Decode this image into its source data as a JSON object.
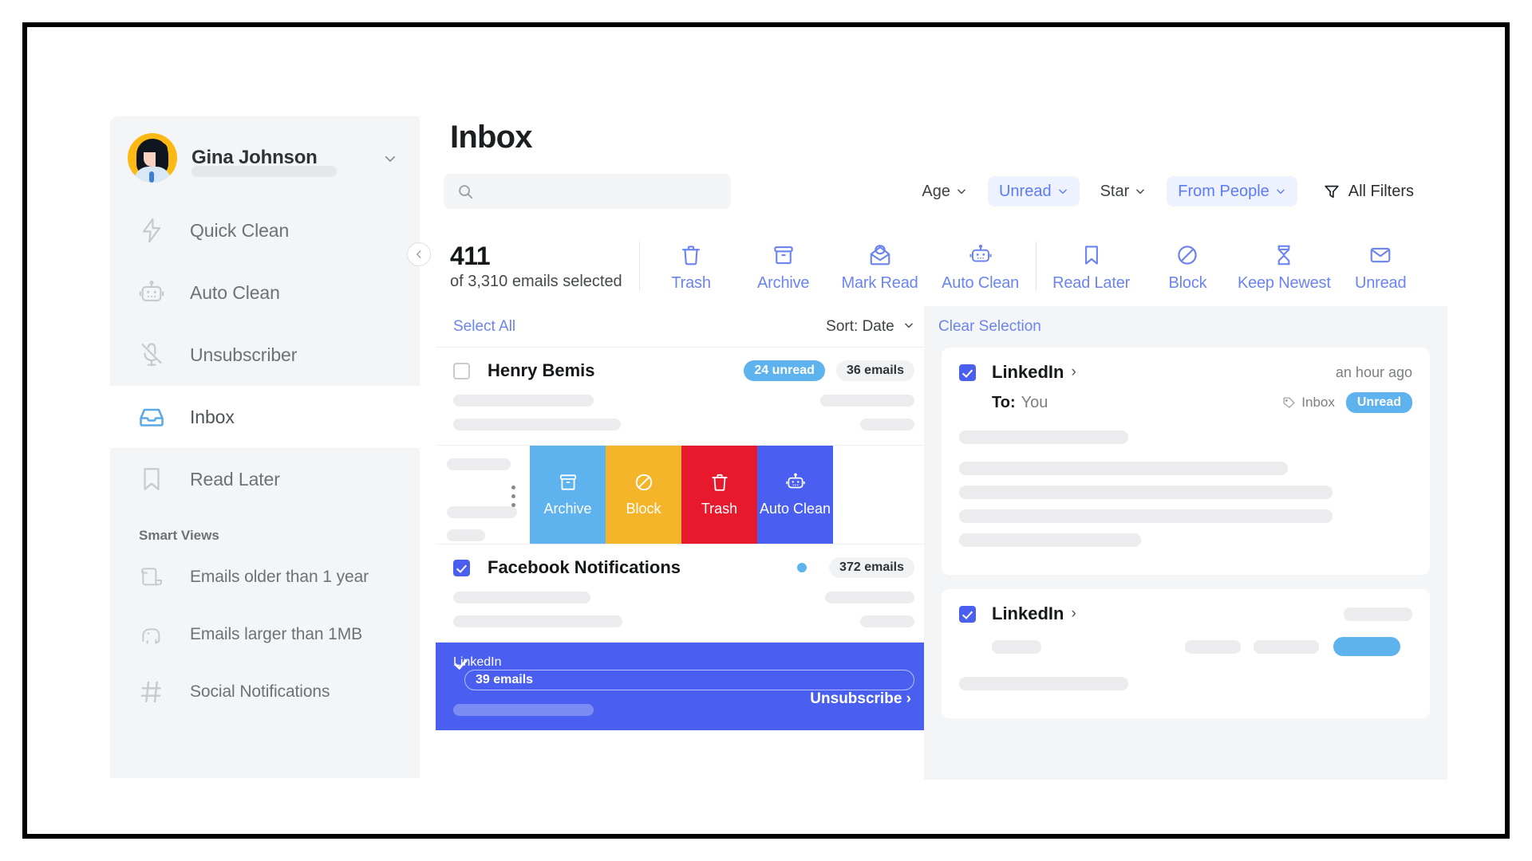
{
  "app": {
    "title": "Inbox"
  },
  "sidebar": {
    "profile": {
      "name": "Gina Johnson",
      "chevron_icon": "chevron-down-icon",
      "avatar_icon": "avatar"
    },
    "items": [
      {
        "label": "Quick Clean",
        "icon": "bolt-icon",
        "active": false
      },
      {
        "label": "Auto Clean",
        "icon": "robot-icon",
        "active": false
      },
      {
        "label": "Unsubscriber",
        "icon": "mic-muted-icon",
        "active": false
      },
      {
        "label": "Inbox",
        "icon": "inbox-icon",
        "active": true
      },
      {
        "label": "Read Later",
        "icon": "bookmark-icon",
        "active": false
      }
    ],
    "smart_views_title": "Smart Views",
    "smart_views": [
      {
        "label": "Emails older than 1 year",
        "icon": "scroll-icon"
      },
      {
        "label": "Emails larger than 1MB",
        "icon": "elephant-icon"
      },
      {
        "label": "Social Notifications",
        "icon": "hash-icon"
      }
    ],
    "collapse_icon": "chevron-left-icon"
  },
  "filters": {
    "search_placeholder": "",
    "search_value": "",
    "search_icon": "search-icon",
    "chips": [
      {
        "label": "Age",
        "active": false,
        "caret": "chevron-down-icon"
      },
      {
        "label": "Unread",
        "active": true,
        "caret": "chevron-down-icon"
      },
      {
        "label": "Star",
        "active": false,
        "caret": "chevron-down-icon"
      },
      {
        "label": "From People",
        "active": true,
        "caret": "chevron-down-icon"
      }
    ],
    "all_filters_label": "All Filters",
    "all_filters_icon": "funnel-icon"
  },
  "selection": {
    "count": "411",
    "summary": "of 3,310 emails selected"
  },
  "actions_primary": [
    {
      "label": "Trash",
      "icon": "trash-icon"
    },
    {
      "label": "Archive",
      "icon": "archive-icon"
    },
    {
      "label": "Mark Read",
      "icon": "open-envelope-icon"
    },
    {
      "label": "Auto Clean",
      "icon": "robot-icon"
    }
  ],
  "actions_secondary": [
    {
      "label": "Read Later",
      "icon": "bookmark-icon"
    },
    {
      "label": "Block",
      "icon": "block-icon"
    },
    {
      "label": "Keep Newest",
      "icon": "hourglass-icon"
    },
    {
      "label": "Unread",
      "icon": "envelope-icon"
    }
  ],
  "list": {
    "select_all_label": "Select All",
    "sort_label": "Sort: Date",
    "sort_caret": "chevron-down-icon",
    "rows": [
      {
        "sender": "Henry Bemis",
        "checked": false,
        "unread_pill": "24 unread",
        "count_pill": "36 emails",
        "show_dot": false
      },
      {
        "sender": "Facebook Notifications",
        "checked": true,
        "unread_pill": "",
        "count_pill": "372 emails",
        "show_dot": true
      },
      {
        "sender": "LinkedIn",
        "checked": true,
        "unread_pill": "",
        "count_pill": "39 emails",
        "show_dot": true,
        "unsubscribe_label": "Unsubscribe ›",
        "selected": true
      }
    ],
    "swipe_actions": [
      {
        "label": "Archive",
        "icon": "archive-icon",
        "color": "#5eb3ef"
      },
      {
        "label": "Block",
        "icon": "block-icon",
        "color": "#f5b52a"
      },
      {
        "label": "Trash",
        "icon": "trash-icon",
        "color": "#e8192c"
      },
      {
        "label": "Auto Clean",
        "icon": "robot-icon",
        "color": "#4a5ff0"
      }
    ],
    "kebab_icon": "more-vertical-icon"
  },
  "detail": {
    "clear_selection_label": "Clear Selection",
    "cards": [
      {
        "sender": "LinkedIn",
        "arrow": "›",
        "timestamp": "an hour ago",
        "to_label": "To:",
        "to_value": "You",
        "folder_label": "Inbox",
        "folder_icon": "tag-icon",
        "status_badge": "Unread",
        "checked": true
      },
      {
        "sender": "LinkedIn",
        "arrow": "›",
        "timestamp": "",
        "to_label": "",
        "to_value": "",
        "folder_label": "",
        "folder_icon": "tag-icon",
        "status_badge": "",
        "checked": true
      }
    ]
  },
  "colors": {
    "accent_blue": "#4a5ff0",
    "link_blue": "#6b84f0",
    "light_blue": "#5eb3ef",
    "amber": "#f5b52a",
    "red": "#e8192c",
    "avatar_yellow": "#fdb913"
  }
}
